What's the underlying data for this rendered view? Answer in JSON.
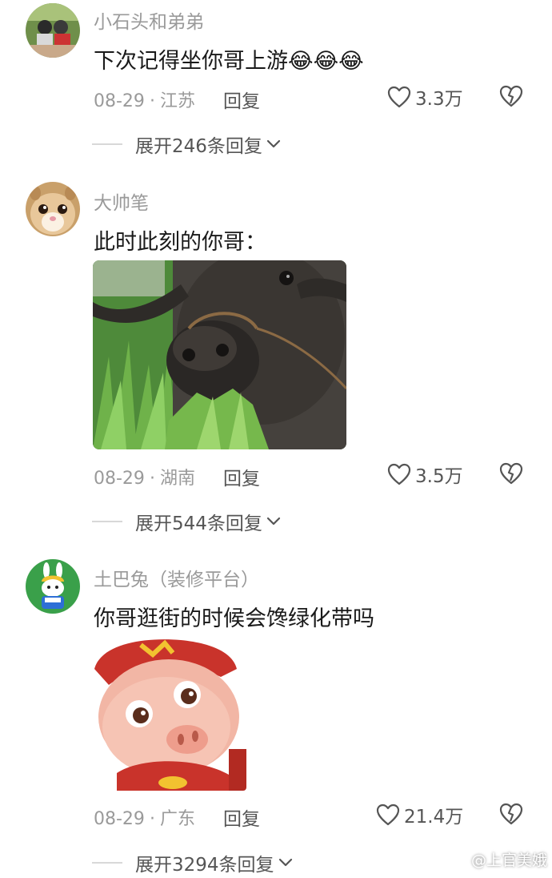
{
  "comments": [
    {
      "username": "小石头和弟弟",
      "text": "下次记得坐你哥上游",
      "emojis": [
        "😂",
        "😂",
        "😂"
      ],
      "date": "08-29",
      "location": "江苏",
      "reply_label": "回复",
      "likes": "3.3万",
      "expand_label": "展开246条回复"
    },
    {
      "username": "大帅笔",
      "text": "此时此刻的你哥：",
      "image": "buffalo-eating-grass",
      "date": "08-29",
      "location": "湖南",
      "reply_label": "回复",
      "likes": "3.5万",
      "expand_label": "展开544条回复"
    },
    {
      "username": "土巴兔（装修平台）",
      "text": "你哥逛街的时候会馋绿化带吗",
      "image": "cartoon-pig-sticker",
      "date": "08-29",
      "location": "广东",
      "reply_label": "回复",
      "likes": "21.4万",
      "expand_label": "展开3294条回复"
    }
  ],
  "watermark": "@上官美娥",
  "colors": {
    "meta_gray": "#9a9a9a",
    "text_dark": "#1a1a1a",
    "action_gray": "#555555"
  }
}
